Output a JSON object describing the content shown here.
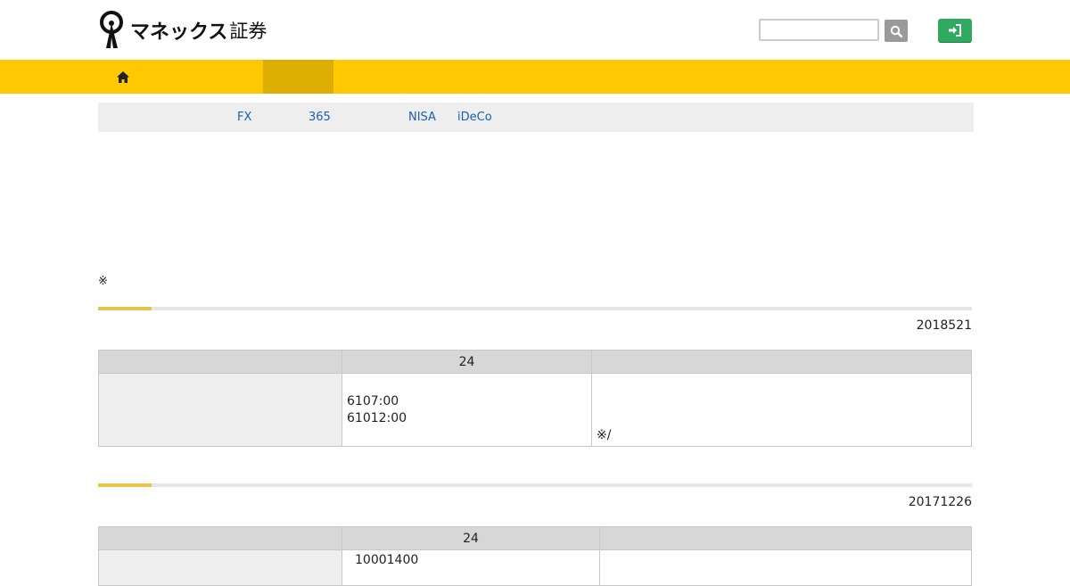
{
  "header": {
    "logo_text": "マネックス",
    "logo_text2": "証券",
    "logo_icon": "monex-figure-logo",
    "search_input_value": "",
    "search_icon": "search-icon",
    "login_icon": "login-icon",
    "login_color": "#2faa5f"
  },
  "nav": {
    "home_icon": "home-icon",
    "bg_color": "#ffc800",
    "active_color": "#dcae00"
  },
  "subnav": {
    "links": [
      "FX",
      "365",
      "NISA",
      "iDeCo"
    ]
  },
  "note": "※",
  "sections": [
    {
      "date": "2018521",
      "headers": [
        "",
        "24",
        ""
      ],
      "times": [
        "6107:00",
        "61012:00"
      ],
      "remark": "※/"
    },
    {
      "date": "20171226",
      "headers": [
        "",
        "24",
        ""
      ],
      "times": [
        "10001400"
      ]
    }
  ]
}
